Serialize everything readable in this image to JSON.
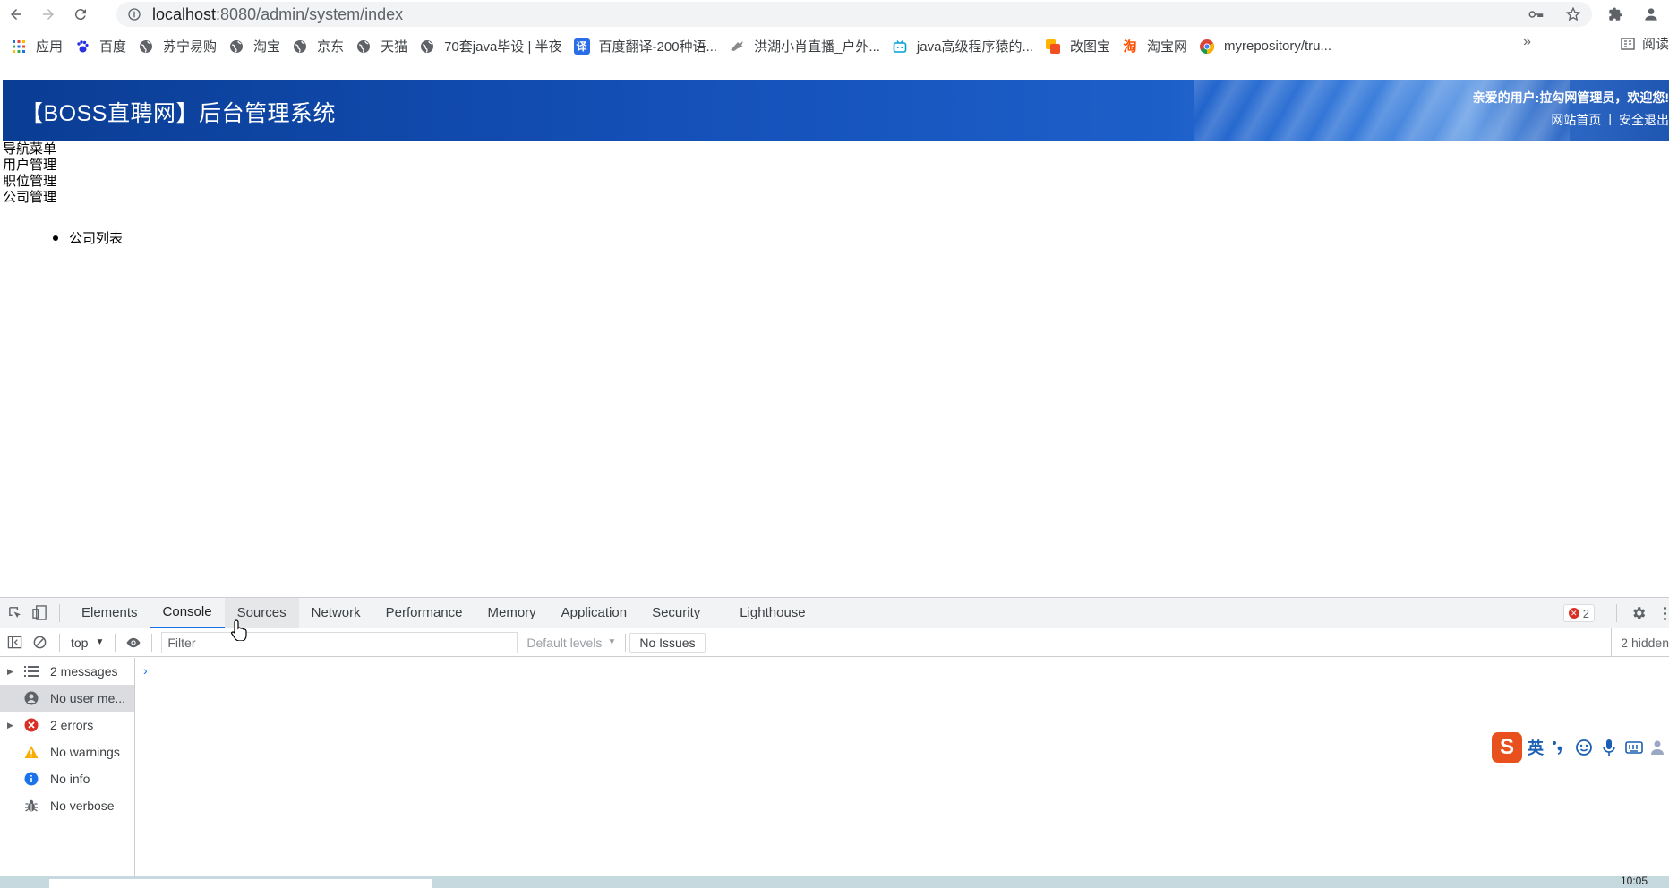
{
  "browser": {
    "url_host": "localhost",
    "url_path": ":8080/admin/system/index",
    "bookmarks": [
      {
        "label": "应用",
        "icon": "apps-grid-icon",
        "color": "#1a73e8"
      },
      {
        "label": "百度",
        "icon": "baidu-paw-icon",
        "color": "#2932e1"
      },
      {
        "label": "苏宁易购",
        "icon": "globe-icon",
        "color": "#5f6368"
      },
      {
        "label": "淘宝",
        "icon": "globe-icon",
        "color": "#5f6368"
      },
      {
        "label": "京东",
        "icon": "globe-icon",
        "color": "#5f6368"
      },
      {
        "label": "天猫",
        "icon": "globe-icon",
        "color": "#5f6368"
      },
      {
        "label": "70套java毕设 | 半夜",
        "icon": "globe-icon",
        "color": "#5f6368"
      },
      {
        "label": "百度翻译-200种语...",
        "icon": "translate-icon",
        "color": "#2b6de6"
      },
      {
        "label": "洪湖小肖直播_户外...",
        "icon": "live-bird-icon",
        "color": "#8a8a8a"
      },
      {
        "label": "java高级程序猿的...",
        "icon": "bilibili-tv-icon",
        "color": "#00a1d6"
      },
      {
        "label": "改图宝",
        "icon": "gaitubao-icon",
        "color": "#f25022"
      },
      {
        "label": "淘宝网",
        "icon": "taobao-icon",
        "color": "#ff5000"
      },
      {
        "label": "myrepository/tru...",
        "icon": "chrome-icon",
        "color": "#db4437"
      }
    ],
    "more": "»",
    "reading_list": "阅读"
  },
  "page": {
    "title": "【BOSS直聘网】后台管理系统",
    "welcome": "亲爱的用户:拉勾网管理员，欢迎您!",
    "home_link": "网站首页",
    "link_sep": "|",
    "logout_link": "安全退出",
    "menu_title": "导航菜单",
    "menu_items": [
      "用户管理",
      "职位管理",
      "公司管理"
    ],
    "submenu_items": [
      "公司列表"
    ]
  },
  "devtools": {
    "tabs": [
      "Elements",
      "Console",
      "Sources",
      "Network",
      "Performance",
      "Memory",
      "Application",
      "Security",
      "Lighthouse"
    ],
    "active_tab": "Console",
    "error_count": "2",
    "context": "top",
    "filter_placeholder": "Filter",
    "levels": "Default levels",
    "issues": "No Issues",
    "hidden": "2 hidden",
    "sidebar": [
      {
        "label": "2 messages",
        "icon": "list-icon",
        "expandable": true
      },
      {
        "label": "No user me...",
        "icon": "user-icon",
        "expandable": false
      },
      {
        "label": "2 errors",
        "icon": "error-icon",
        "expandable": true
      },
      {
        "label": "No warnings",
        "icon": "warning-icon",
        "expandable": false
      },
      {
        "label": "No info",
        "icon": "info-icon",
        "expandable": false
      },
      {
        "label": "No verbose",
        "icon": "bug-icon",
        "expandable": false
      }
    ],
    "prompt": "›"
  },
  "ime": {
    "logo": "S",
    "mode": "英"
  },
  "taskbar": {
    "clock": "10:05"
  }
}
